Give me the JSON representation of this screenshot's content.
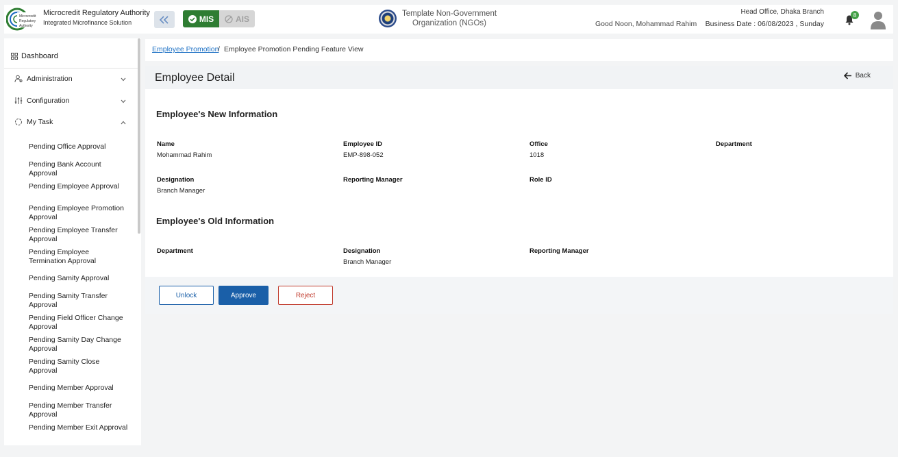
{
  "header": {
    "org_title": "Microcredit Regulatory Authority",
    "org_subtitle": "Integrated Microfinance Solution",
    "logo_text": "Microcredit Regulatory Authority",
    "mode_active": "MIS",
    "mode_inactive": "AIS",
    "ngo_name": "Template Non-Government Organization (NGOs)",
    "greeting": "Good Noon, Mohammad Rahim",
    "branch": "Head Office, Dhaka Branch",
    "business_date": "Business Date : 06/08/2023 , Sunday",
    "notification_count": "8",
    "accent": "#2e7d32"
  },
  "sidebar": {
    "dashboard": "Dashboard",
    "groups": [
      {
        "label": "Administration",
        "icon": "admin-icon",
        "expanded": false
      },
      {
        "label": "Configuration",
        "icon": "config-icon",
        "expanded": false
      },
      {
        "label": "My Task",
        "icon": "task-icon",
        "expanded": true
      }
    ],
    "items": [
      "Pending Office Approval",
      "Pending Bank Account Approval",
      "Pending Employee Approval",
      "Pending Employee Promotion Approval",
      "Pending Employee Transfer Approval",
      "Pending Employee Termination Approval",
      "Pending Samity Approval",
      "Pending Samity Transfer Approval",
      "Pending Field Officer Change Approval",
      "Pending Samity Day Change Approval",
      "Pending Samity Close Approval",
      "Pending Member Approval",
      "Pending Member Transfer Approval",
      "Pending Member Exit Approval"
    ]
  },
  "breadcrumb": {
    "link": "Employee Promotion",
    "separator": "/",
    "current": "Employee Promotion Pending Feature View"
  },
  "page": {
    "title": "Employee Detail",
    "back_label": "Back"
  },
  "new_info": {
    "heading": "Employee's New Information",
    "fields": [
      {
        "label": "Name",
        "value": "Mohammad Rahim"
      },
      {
        "label": "Employee ID",
        "value": "EMP-898-052"
      },
      {
        "label": "Office",
        "value": "1018"
      },
      {
        "label": "Department",
        "value": ""
      },
      {
        "label": "Designation",
        "value": "Branch Manager"
      },
      {
        "label": "Reporting Manager",
        "value": ""
      },
      {
        "label": "Role ID",
        "value": ""
      }
    ]
  },
  "old_info": {
    "heading": "Employee's Old Information",
    "fields": [
      {
        "label": "Department",
        "value": ""
      },
      {
        "label": "Designation",
        "value": "Branch Manager"
      },
      {
        "label": "Reporting Manager",
        "value": ""
      }
    ]
  },
  "actions": {
    "unlock": "Unlock",
    "approve": "Approve",
    "reject": "Reject"
  }
}
